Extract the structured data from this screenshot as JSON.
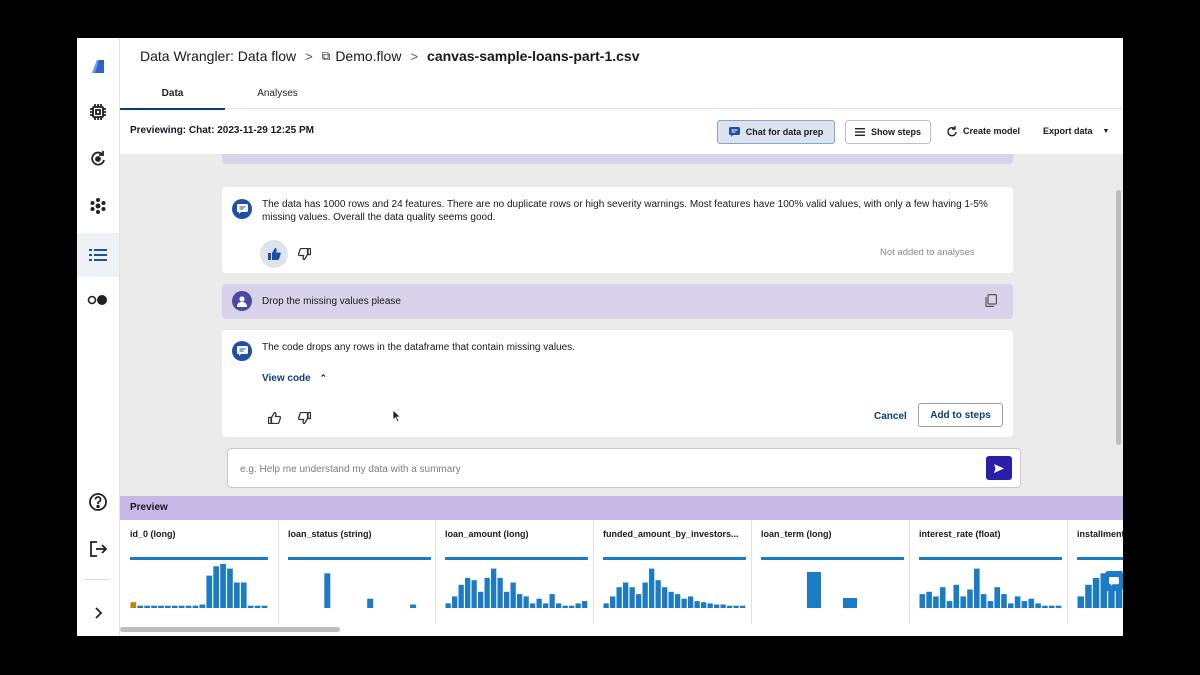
{
  "breadcrumb": {
    "root": "Data Wrangler: Data flow",
    "flow": "Demo.flow",
    "file": "canvas-sample-loans-part-1.csv"
  },
  "tabs": [
    {
      "label": "Data",
      "active": true
    },
    {
      "label": "Analyses",
      "active": false
    }
  ],
  "toolbar": {
    "previewing": "Previewing: Chat: 2023-11-29 12:25 PM",
    "chat_label": "Chat for data prep",
    "show_steps_label": "Show steps",
    "create_model_label": "Create model",
    "export_data_label": "Export data"
  },
  "chat": {
    "bot_summary": "The data has 1000 rows and 24 features. There are no duplicate rows or high severity warnings. Most features have 100% valid values, with only a few having 1-5% missing values. Overall the data quality seems good.",
    "not_added": "Not added to analyses",
    "user_message": "Drop the missing values please",
    "bot_code_response": "The code drops any rows in the dataframe that contain missing values.",
    "view_code": "View code",
    "cancel": "Cancel",
    "add_to_steps": "Add to steps",
    "input_placeholder": "e.g. Help me understand my data with a summary"
  },
  "preview": {
    "title": "Preview",
    "columns": [
      {
        "name": "id_0 (long)",
        "bars": [
          5,
          2,
          2,
          2,
          2,
          2,
          2,
          2,
          2,
          2,
          3,
          28,
          36,
          38,
          34,
          22,
          22,
          2,
          2,
          2
        ]
      },
      {
        "name": "loan_status (string)",
        "bars": [
          0,
          0,
          0,
          0,
          0,
          30,
          0,
          0,
          0,
          0,
          0,
          8,
          0,
          0,
          0,
          0,
          0,
          3,
          0,
          0
        ]
      },
      {
        "name": "loan_amount (long)",
        "bars": [
          4,
          10,
          20,
          26,
          24,
          14,
          26,
          34,
          26,
          14,
          22,
          12,
          10,
          4,
          8,
          4,
          12,
          4,
          2,
          2,
          4,
          6
        ]
      },
      {
        "name": "funded_amount_by_investors...",
        "bars": [
          4,
          10,
          18,
          22,
          18,
          12,
          22,
          34,
          24,
          18,
          14,
          12,
          8,
          10,
          6,
          5,
          4,
          3,
          3,
          2,
          2,
          2
        ]
      },
      {
        "name": "loan_term (long)",
        "bars": [
          0,
          0,
          0,
          0,
          0,
          0,
          0,
          0,
          0,
          0,
          0,
          0,
          0,
          0,
          0,
          0,
          0,
          0,
          0,
          0,
          0,
          0
        ]
      },
      {
        "name": "interest_rate (float)",
        "bars": [
          12,
          14,
          10,
          18,
          6,
          20,
          10,
          16,
          34,
          12,
          6,
          18,
          12,
          4,
          10,
          6,
          8,
          4,
          2,
          2,
          2
        ]
      },
      {
        "name": "installment",
        "bars": [
          10,
          20,
          26,
          30,
          28,
          32
        ]
      }
    ]
  },
  "colors": {
    "accent": "#0b3d7a",
    "bar": "#1b7bc4",
    "preview_header": "#c5b7e6",
    "user_message_bg": "#d8d3ea",
    "send_button": "#2a1fa8"
  },
  "icons": [
    "canvas-logo-icon",
    "chip-icon",
    "model-cycle-icon",
    "asterisk-icon",
    "list-icon",
    "toggle-icon",
    "help-icon",
    "signout-icon",
    "expand-icon"
  ]
}
